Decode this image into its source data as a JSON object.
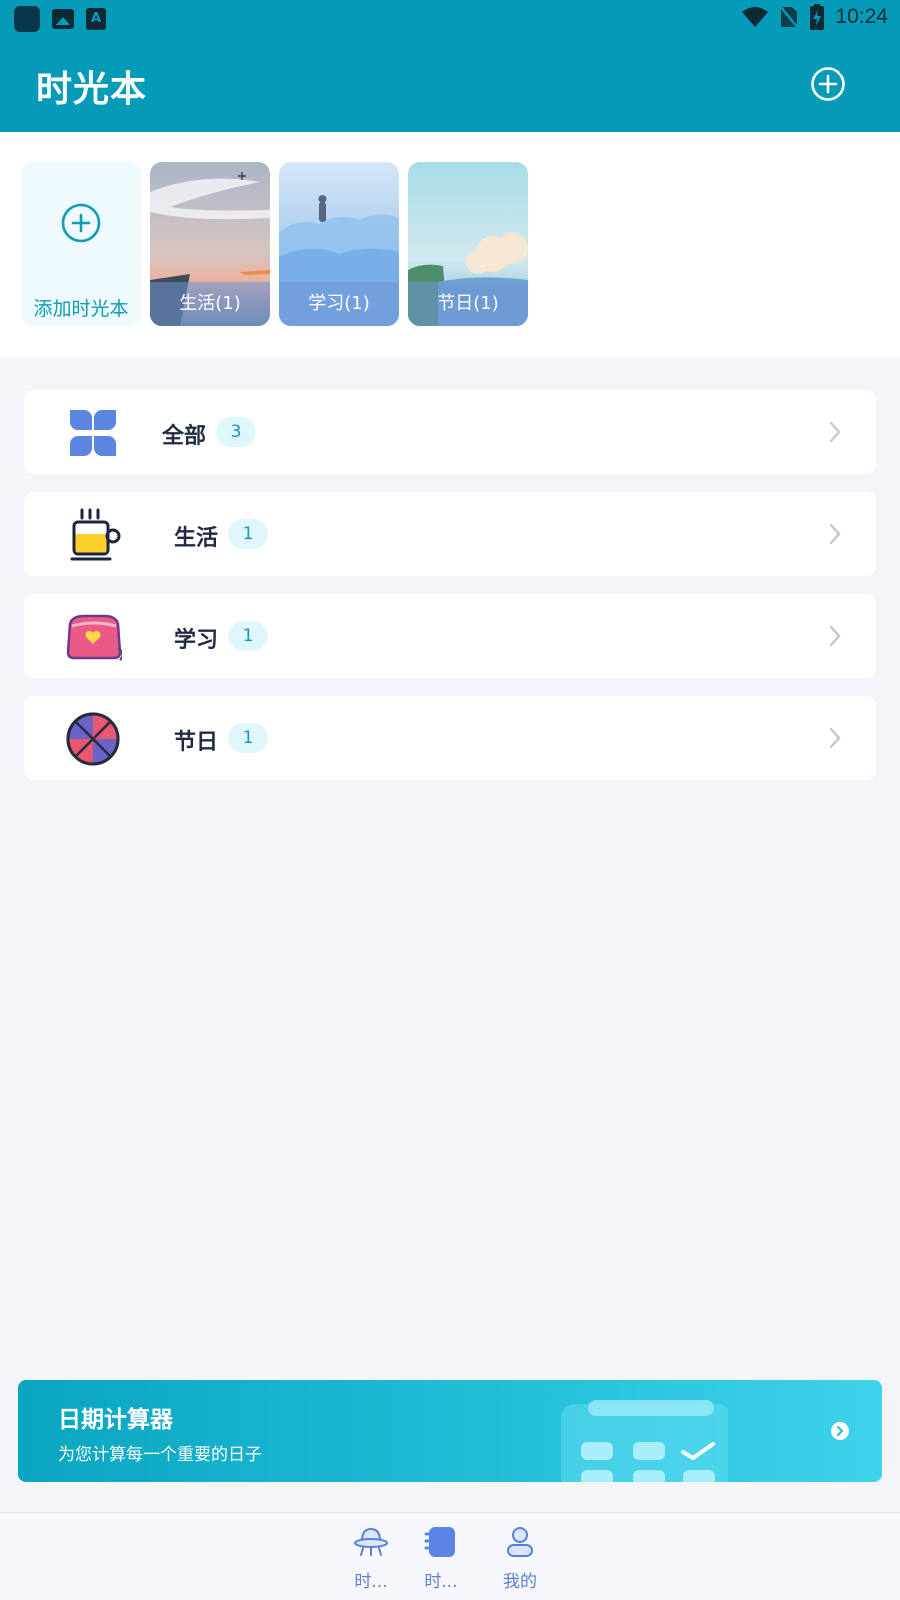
{
  "status_bar": {
    "time": "10:24",
    "icons": [
      "app-icon",
      "image-icon",
      "font-icon",
      "wifi-icon",
      "no-sim-icon",
      "battery-charging-icon"
    ]
  },
  "header": {
    "title": "时光本",
    "add_icon": "plus-circle-icon"
  },
  "notebooks": {
    "add_label": "添加时光本",
    "items": [
      {
        "label": "生活(1)"
      },
      {
        "label": "学习(1)"
      },
      {
        "label": "节日(1)"
      }
    ]
  },
  "categories": [
    {
      "name": "全部",
      "count": "3",
      "icon": "four-petal-icon"
    },
    {
      "name": "生活",
      "count": "1",
      "icon": "coffee-cup-icon"
    },
    {
      "name": "学习",
      "count": "1",
      "icon": "pencil-case-icon"
    },
    {
      "name": "节日",
      "count": "1",
      "icon": "basketball-icon"
    }
  ],
  "banner": {
    "title": "日期计算器",
    "subtitle": "为您计算每一个重要的日子"
  },
  "bottom_nav": {
    "items": [
      {
        "label": "时...",
        "icon": "ufo-icon"
      },
      {
        "label": "时...",
        "icon": "notebook-icon",
        "active": true
      },
      {
        "label": "我的",
        "icon": "person-icon"
      }
    ]
  },
  "colors": {
    "header": "#049bb9",
    "accent": "#0d9bb5",
    "nav_accent": "#5a7fd8",
    "background": "#f3f5f9"
  }
}
